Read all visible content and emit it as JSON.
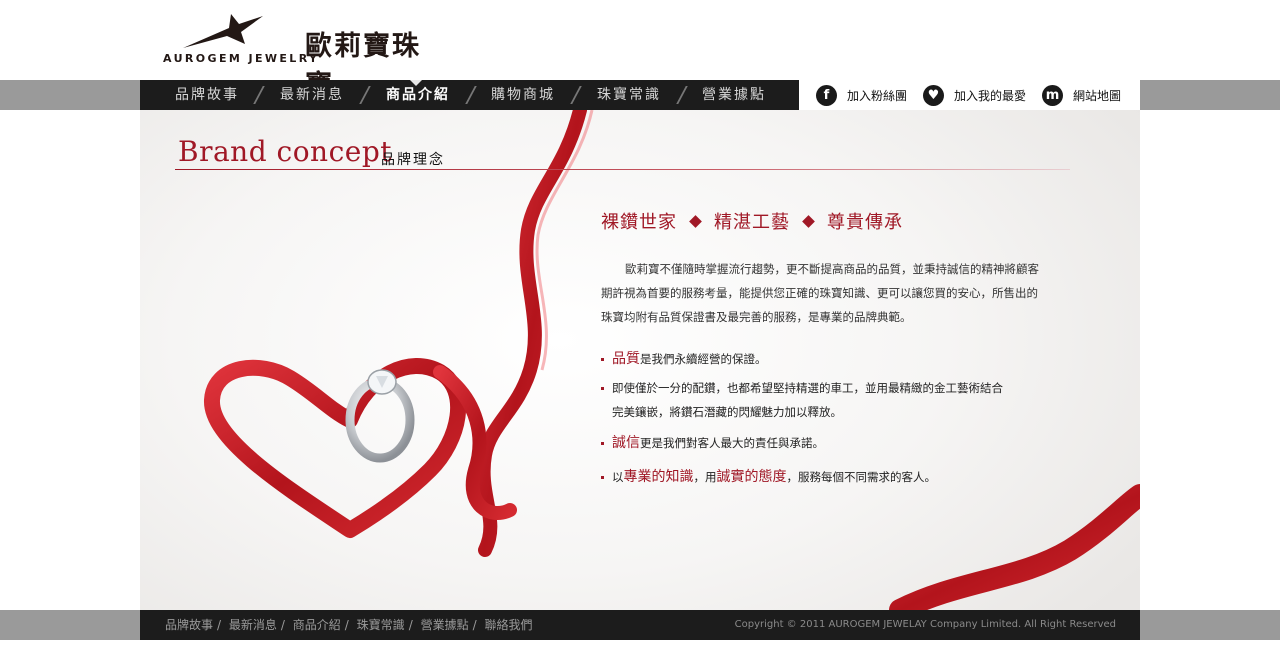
{
  "brand": {
    "name_en": "AUROGEM JEWELRY",
    "name_zh": "歐莉寶珠寶",
    "logo_icon": "star-logo-icon"
  },
  "nav": {
    "items": [
      {
        "label": "品牌故事"
      },
      {
        "label": "最新消息"
      },
      {
        "label": "商品介紹",
        "active": true
      },
      {
        "label": "購物商城"
      },
      {
        "label": "珠寶常識"
      },
      {
        "label": "營業據點"
      }
    ]
  },
  "social": {
    "fans": {
      "label": "加入粉絲團",
      "icon": "facebook-icon"
    },
    "favorite": {
      "label": "加入我的最愛",
      "icon": "heart-icon"
    },
    "sitemap": {
      "label": "網站地圖",
      "icon": "sitemap-icon"
    }
  },
  "concept": {
    "title": "Brand concept",
    "subtitle": "品牌理念",
    "tagline": [
      "裸鑽世家",
      "精湛工藝",
      "尊貴傳承"
    ],
    "intro": "歐莉寶不僅隨時掌握流行趨勢，更不斷提高商品的品質，並秉持誠信的精神將顧客期許視為首要的服務考量，能提供您正確的珠寶知識、更可以讓您買的安心，所售出的珠寶均附有品質保證書及最完善的服務，是專業的品牌典範。",
    "points": [
      {
        "hl": "品質",
        "text": "是我們永續經營的保證。"
      },
      {
        "text1": "即使僅於一分的配鑽，也都希望堅持精選的車工，並用最精緻的金工藝術結合",
        "text2": "完美鑲嵌，將鑽石潛藏的閃耀魅力加以釋放。"
      },
      {
        "hl": "誠信",
        "text": "更是我們對客人最大的責任與承諾。"
      },
      {
        "pre": "以",
        "hl1": "專業的知識",
        "mid": "，用",
        "hl2": "誠實的態度",
        "post": "，服務每個不同需求的客人。"
      }
    ]
  },
  "footer": {
    "links": [
      "品牌故事",
      "最新消息",
      "商品介紹",
      "珠寶常識",
      "營業據點",
      "聯絡我們"
    ],
    "separator": "/",
    "copyright": "Copyright © 2011 AUROGEM JEWELAY Company Limited. All Right Reserved"
  },
  "colors": {
    "accent": "#a01826",
    "nav_bg": "#1c1c1c",
    "band_gray": "#9a9a9a"
  }
}
